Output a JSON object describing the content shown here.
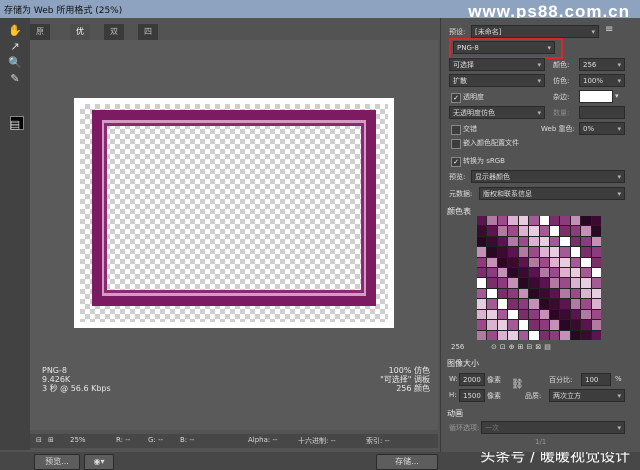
{
  "title": "存储为 Web 所用格式 (25%)",
  "watermark_top": "www.ps88.com.cn",
  "watermark_bottom": "头条号 / 暖暖视觉设计",
  "tabs": [
    "原稿",
    "优化",
    "双联",
    "四联"
  ],
  "active_tab": 1,
  "preview_info_left": [
    "PNG-8",
    "9.426K",
    "3 秒 @ 56.6 Kbps"
  ],
  "preview_info_right": [
    "100% 仿色",
    "\"可选择\" 调板",
    "256 颜色"
  ],
  "bottom_bar": {
    "zoom": "25%",
    "r": "R: --",
    "g": "G: --",
    "b": "B: --",
    "alpha": "Alpha: --",
    "hex": "十六进制: --",
    "index": "索引: --"
  },
  "footer": {
    "preview": "预览...",
    "save": "存储..."
  },
  "panel": {
    "preset_label": "预设:",
    "preset_value": "[未命名]",
    "format": "PNG-8",
    "reduction": "可选择",
    "colors_label": "颜色:",
    "colors_value": "256",
    "dither_algo": "扩散",
    "dither_label": "仿色:",
    "dither_value": "100%",
    "transparency": "透明度",
    "matte_label": "杂边:",
    "transparency_dither": "无透明度仿色",
    "amount_label": "数量:",
    "interlaced": "交错",
    "websnap_label": "Web 靠色:",
    "websnap_value": "0%",
    "embed_profile": "嵌入颜色配置文件",
    "convert_srgb": "转换为 sRGB",
    "preview_label": "预览:",
    "preview_value": "显示器颜色",
    "metadata_label": "元数据:",
    "metadata_value": "版权和联系信息",
    "color_table": "颜色表",
    "color_count": "256",
    "image_size": "图像大小",
    "w_label": "W:",
    "w_value": "2000",
    "h_label": "H:",
    "h_value": "1500",
    "px": "像素",
    "percent_label": "百分比:",
    "percent_value": "100",
    "percent_unit": "%",
    "quality_label": "品质:",
    "quality_value": "两次立方",
    "animation": "动画",
    "loop_label": "循环选项:",
    "loop_value": "一次",
    "frame_counter": "1/1"
  },
  "colors": {
    "frame": "#7c1a62",
    "highlight": "#d42a2a"
  }
}
